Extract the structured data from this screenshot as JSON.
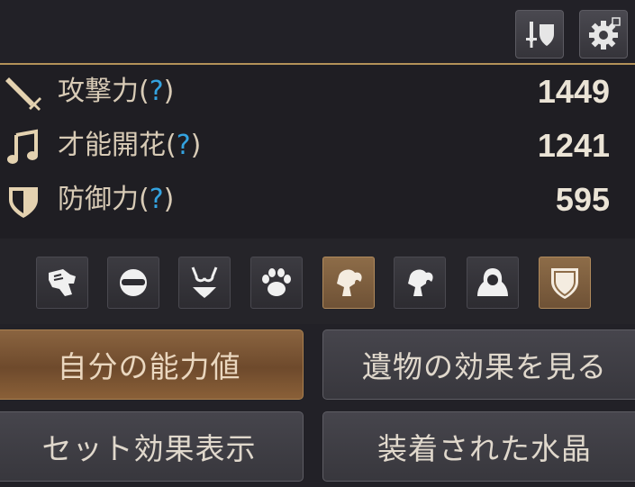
{
  "header": {
    "icons": [
      "sword-shield-icon",
      "gear-icon"
    ]
  },
  "stats": [
    {
      "icon": "sword-icon",
      "label": "攻撃力",
      "paren_open": "(",
      "help": "?",
      "paren_close": ")",
      "value": "1449"
    },
    {
      "icon": "music-note-icon",
      "label": "才能開花",
      "paren_open": "(",
      "help": "?",
      "paren_close": ")",
      "value": "1241"
    },
    {
      "icon": "shield-icon",
      "label": "防御力",
      "paren_open": "(",
      "help": "?",
      "paren_close": ")",
      "value": "595"
    }
  ],
  "equipment_slots": [
    {
      "icon": "gauntlet-icon",
      "active": false
    },
    {
      "icon": "mask-icon",
      "active": false
    },
    {
      "icon": "bikini-armor-icon",
      "active": false
    },
    {
      "icon": "paw-icon",
      "active": false
    },
    {
      "icon": "ponytail-hair-icon",
      "active": true
    },
    {
      "icon": "ponytail-hair-icon",
      "active": false
    },
    {
      "icon": "hooded-figure-icon",
      "active": false
    },
    {
      "icon": "shield-icon",
      "active": true
    }
  ],
  "buttons": {
    "my_stats": "自分の能力値",
    "relic_effects": "遺物の効果を見る",
    "set_effects": "セット効果表示",
    "equipped_crystals": "装着された水晶"
  },
  "colors": {
    "accent_gold": "#b39258",
    "help_blue": "#34a3e0",
    "active_brown": "#8d6c48"
  }
}
